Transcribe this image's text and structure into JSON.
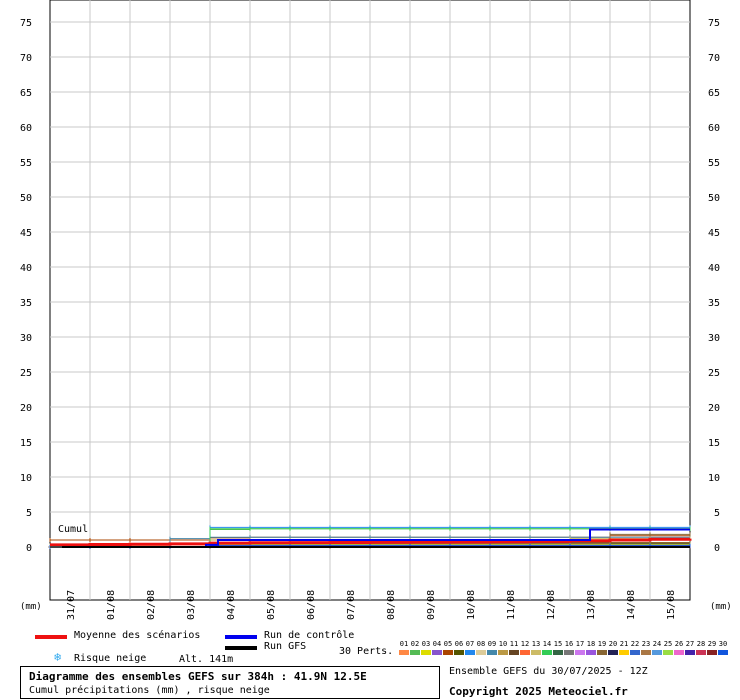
{
  "chart_data": {
    "type": "line",
    "title": "Diagramme des ensembles GEFS sur 384h : 41.9N 12.5E",
    "subtitle": "Cumul précipitations (mm) , risque neige",
    "ylabel_left": "(mm)",
    "ylabel_right": "(mm)",
    "ylim": [
      -5,
      78
    ],
    "yticks": [
      0,
      5,
      10,
      15,
      20,
      25,
      30,
      35,
      40,
      45,
      50,
      55,
      60,
      65,
      70,
      75
    ],
    "xlim": [
      0,
      16
    ],
    "xtick_labels": [
      "31/07",
      "01/08",
      "02/08",
      "03/08",
      "04/08",
      "05/08",
      "06/08",
      "07/08",
      "08/08",
      "09/08",
      "10/08",
      "11/08",
      "12/08",
      "13/08",
      "14/08",
      "15/08"
    ],
    "xticks": [
      0.5,
      1.5,
      2.5,
      3.5,
      4.5,
      5.5,
      6.5,
      7.5,
      8.5,
      9.5,
      10.5,
      11.5,
      12.5,
      13.5,
      14.5,
      15.5
    ],
    "cumul_label": "Cumul",
    "grid": true,
    "series": [
      {
        "name": "Moyenne des scénarios",
        "color": "#ee1111",
        "width": 3,
        "x": [
          0,
          1,
          2,
          3,
          4,
          5,
          6,
          7,
          8,
          9,
          10,
          11,
          12,
          13,
          14,
          15,
          16
        ],
        "y": [
          0.3,
          0.35,
          0.4,
          0.45,
          0.55,
          0.6,
          0.62,
          0.65,
          0.68,
          0.7,
          0.72,
          0.75,
          0.8,
          0.9,
          1.0,
          1.1,
          1.2
        ]
      },
      {
        "name": "Run de contrôle",
        "color": "#0000ee",
        "width": 2,
        "x": [
          0,
          3.3,
          3.9,
          4.2,
          5,
          13.3,
          13.5,
          16
        ],
        "y": [
          0,
          0,
          0.3,
          1.0,
          1.0,
          1.0,
          2.5,
          2.5
        ]
      },
      {
        "name": "Run GFS",
        "color": "#000000",
        "width": 2,
        "x": [
          0,
          16
        ],
        "y": [
          0,
          0
        ]
      }
    ],
    "perturbations": [
      {
        "id": "01",
        "color": "#ff8844",
        "y": [
          0.2,
          0.3,
          0.4,
          0.5,
          0.6,
          0.6,
          0.6,
          0.6,
          0.6,
          0.6,
          0.6,
          0.6,
          0.6,
          0.6,
          0.6,
          0.6,
          0.6
        ]
      },
      {
        "id": "02",
        "color": "#55bb55",
        "y": [
          0,
          0,
          0,
          0,
          2.5,
          2.6,
          2.6,
          2.6,
          2.6,
          2.6,
          2.6,
          2.6,
          2.6,
          2.6,
          2.6,
          2.6,
          2.6
        ]
      },
      {
        "id": "03",
        "color": "#dddd00",
        "y": [
          0,
          0,
          0,
          0.5,
          0.6,
          0.6,
          0.6,
          0.6,
          0.6,
          0.6,
          0.6,
          0.6,
          0.6,
          0.6,
          0.6,
          0.6,
          0.6
        ]
      },
      {
        "id": "04",
        "color": "#8855cc",
        "y": [
          0,
          0,
          0,
          0,
          0,
          0,
          0,
          0,
          0,
          0,
          0,
          0,
          0,
          0.3,
          0.4,
          0.4,
          0.4
        ]
      },
      {
        "id": "05",
        "color": "#aa4400",
        "y": [
          1.0,
          1.0,
          1.0,
          1.0,
          1.3,
          1.4,
          1.4,
          1.4,
          1.4,
          1.4,
          1.4,
          1.4,
          1.4,
          1.4,
          1.6,
          1.6,
          1.6
        ]
      },
      {
        "id": "06",
        "color": "#555500",
        "y": [
          0,
          0,
          0,
          0,
          0.5,
          0.5,
          0.5,
          0.5,
          0.5,
          0.5,
          0.5,
          0.5,
          0.5,
          0.5,
          0.5,
          0.5,
          0.5
        ]
      },
      {
        "id": "07",
        "color": "#2288ee",
        "y": [
          0,
          0,
          0,
          0,
          2.8,
          2.8,
          2.8,
          2.8,
          2.8,
          2.8,
          2.8,
          2.8,
          2.8,
          2.8,
          2.8,
          2.8,
          2.8
        ]
      },
      {
        "id": "08",
        "color": "#ddcc99",
        "y": [
          0.2,
          0.2,
          0.2,
          0.3,
          0.4,
          0.4,
          0.4,
          0.4,
          0.4,
          0.4,
          0.4,
          0.4,
          0.4,
          0.4,
          0.4,
          0.4,
          0.4
        ]
      },
      {
        "id": "09",
        "color": "#4488aa",
        "y": [
          0,
          0,
          0,
          1.2,
          1.4,
          1.4,
          1.4,
          1.4,
          1.4,
          1.4,
          1.4,
          1.4,
          1.4,
          1.4,
          1.4,
          1.4,
          1.4
        ]
      },
      {
        "id": "10",
        "color": "#bb9944",
        "y": [
          0,
          0,
          0,
          0,
          1.0,
          1.0,
          1.0,
          1.0,
          1.0,
          1.0,
          1.0,
          1.0,
          1.0,
          1.0,
          1.0,
          1.0,
          1.0
        ]
      },
      {
        "id": "11",
        "color": "#664422",
        "y": [
          0,
          0,
          0,
          0,
          0.6,
          0.6,
          0.6,
          0.6,
          0.6,
          0.6,
          0.6,
          0.6,
          0.6,
          0.6,
          0.6,
          0.6,
          0.6
        ]
      },
      {
        "id": "12",
        "color": "#ff6633",
        "y": [
          0,
          0,
          0,
          0,
          0.3,
          0.3,
          0.3,
          0.3,
          0.3,
          0.3,
          0.3,
          0.3,
          0.3,
          0.3,
          0.3,
          0.3,
          0.3
        ]
      },
      {
        "id": "13",
        "color": "#ccbb66",
        "y": [
          0,
          0,
          0,
          0,
          0,
          0,
          0,
          0,
          0,
          0,
          0,
          0,
          0,
          1.2,
          1.2,
          1.2,
          1.2
        ]
      },
      {
        "id": "14",
        "color": "#33cc55",
        "y": [
          0,
          0,
          0,
          0,
          2.6,
          2.6,
          2.6,
          2.6,
          2.6,
          2.6,
          2.6,
          2.6,
          2.6,
          2.6,
          2.6,
          2.6,
          2.6
        ]
      },
      {
        "id": "15",
        "color": "#336644",
        "y": [
          0,
          0,
          0,
          0,
          0.4,
          0.4,
          0.4,
          0.4,
          0.4,
          0.4,
          0.4,
          0.4,
          0.4,
          0.4,
          0.4,
          0.4,
          0.4
        ]
      },
      {
        "id": "16",
        "color": "#777777",
        "y": [
          0,
          0,
          0,
          0,
          0.2,
          0.2,
          0.2,
          0.2,
          0.2,
          0.2,
          0.2,
          0.2,
          0.2,
          0.2,
          0.2,
          0.2,
          0.2
        ]
      },
      {
        "id": "17",
        "color": "#cc77ee",
        "y": [
          0,
          0,
          0,
          0,
          0.3,
          0.3,
          0.3,
          0.3,
          0.3,
          0.3,
          0.3,
          0.3,
          0.3,
          0.3,
          0.3,
          0.3,
          0.3
        ]
      },
      {
        "id": "18",
        "color": "#9955dd",
        "y": [
          0,
          0,
          0,
          0,
          0.2,
          0.2,
          0.2,
          0.2,
          0.2,
          0.2,
          0.2,
          0.2,
          0.2,
          0.2,
          0.2,
          0.2,
          0.2
        ]
      },
      {
        "id": "19",
        "color": "#886633",
        "y": [
          0,
          0,
          0,
          0,
          0.5,
          0.5,
          0.5,
          0.5,
          0.5,
          0.5,
          0.5,
          0.5,
          0.5,
          0.5,
          1.8,
          1.8,
          1.8
        ]
      },
      {
        "id": "20",
        "color": "#222255",
        "y": [
          0,
          0,
          0,
          0,
          0.1,
          0.1,
          0.1,
          0.1,
          0.1,
          0.1,
          0.1,
          0.1,
          0.1,
          0.1,
          0.1,
          0.1,
          0.1
        ]
      },
      {
        "id": "21",
        "color": "#ffcc00",
        "y": [
          0,
          0,
          0,
          0,
          0.3,
          0.3,
          0.3,
          0.3,
          0.3,
          0.3,
          0.3,
          0.3,
          0.3,
          0.3,
          0.3,
          0.3,
          0.3
        ]
      },
      {
        "id": "22",
        "color": "#3366cc",
        "y": [
          0,
          0,
          0,
          0,
          0.2,
          0.2,
          0.2,
          0.2,
          0.2,
          0.2,
          0.2,
          0.2,
          0.2,
          0.2,
          0.2,
          0.2,
          0.2
        ]
      },
      {
        "id": "23",
        "color": "#aa7744",
        "y": [
          0,
          0,
          0,
          0,
          0.4,
          0.4,
          0.4,
          0.4,
          0.4,
          0.4,
          0.4,
          0.4,
          0.4,
          0.4,
          0.4,
          0.4,
          0.4
        ]
      },
      {
        "id": "24",
        "color": "#5599dd",
        "y": [
          0,
          0,
          0,
          0,
          0.2,
          0.2,
          0.2,
          0.2,
          0.2,
          0.2,
          0.2,
          0.2,
          0.2,
          0.2,
          0.2,
          0.2,
          0.2
        ]
      },
      {
        "id": "25",
        "color": "#99dd44",
        "y": [
          0,
          0,
          0,
          0,
          0.3,
          0.3,
          0.3,
          0.3,
          0.3,
          0.3,
          0.3,
          0.3,
          0.3,
          0.3,
          0.3,
          0.3,
          0.3
        ]
      },
      {
        "id": "26",
        "color": "#ee66cc",
        "y": [
          0,
          0,
          0,
          0,
          0.2,
          0.2,
          0.2,
          0.2,
          0.2,
          0.2,
          0.2,
          0.2,
          0.2,
          0.2,
          0.2,
          0.2,
          0.2
        ]
      },
      {
        "id": "27",
        "color": "#4422aa",
        "y": [
          0,
          0,
          0,
          0,
          0.1,
          0.1,
          0.1,
          0.1,
          0.1,
          0.1,
          0.1,
          0.1,
          0.1,
          0.1,
          0.1,
          0.1,
          0.1
        ]
      },
      {
        "id": "28",
        "color": "#cc3355",
        "y": [
          0,
          0,
          0,
          0,
          0.2,
          0.2,
          0.2,
          0.2,
          0.2,
          0.2,
          0.2,
          0.2,
          0.2,
          0.2,
          0.2,
          0.2,
          0.2
        ]
      },
      {
        "id": "29",
        "color": "#882222",
        "y": [
          0,
          0,
          0,
          0,
          0.1,
          0.1,
          0.1,
          0.1,
          0.1,
          0.1,
          0.1,
          0.1,
          0.1,
          0.1,
          0.1,
          0.1,
          0.1
        ]
      },
      {
        "id": "30",
        "color": "#1155dd",
        "y": [
          0,
          0,
          0,
          0,
          0.2,
          0.2,
          0.2,
          0.2,
          0.2,
          0.2,
          0.2,
          0.2,
          0.2,
          0.2,
          0.2,
          0.2,
          0.2
        ]
      }
    ]
  },
  "legend": {
    "mean_label": "Moyenne des scénarios",
    "control_label": "Run de contrôle",
    "gfs_label": "Run GFS",
    "snow_label": "Risque neige",
    "altitude": "Alt. 141m",
    "perts_label": "30 Perts."
  },
  "footer": {
    "title": "Diagramme des ensembles GEFS sur 384h : 41.9N 12.5E",
    "subtitle": "Cumul précipitations (mm) , risque neige",
    "run_info": "Ensemble GEFS du 30/07/2025 - 12Z",
    "copyright": "Copyright 2025 Meteociel.fr"
  },
  "icons": {
    "snow": "snowflake-icon"
  },
  "colors": {
    "mean": "#ee1111",
    "control": "#0000ee",
    "gfs": "#000000",
    "grid": "#c8c8c8"
  }
}
